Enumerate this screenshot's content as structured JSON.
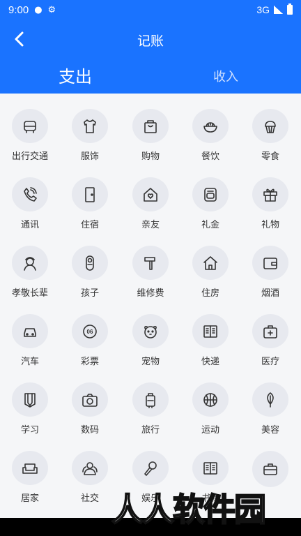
{
  "status": {
    "time": "9:00",
    "network": "3G"
  },
  "header": {
    "title": "记账"
  },
  "tabs": [
    {
      "label": "支出"
    },
    {
      "label": "收入"
    }
  ],
  "categories": [
    {
      "label": "出行交通",
      "icon": "car-icon"
    },
    {
      "label": "服饰",
      "icon": "shirt-icon"
    },
    {
      "label": "购物",
      "icon": "bag-icon"
    },
    {
      "label": "餐饮",
      "icon": "bowl-icon"
    },
    {
      "label": "零食",
      "icon": "cupcake-icon"
    },
    {
      "label": "通讯",
      "icon": "phone-icon"
    },
    {
      "label": "住宿",
      "icon": "door-icon"
    },
    {
      "label": "亲友",
      "icon": "home-heart-icon"
    },
    {
      "label": "礼金",
      "icon": "gift-envelope-icon"
    },
    {
      "label": "礼物",
      "icon": "gift-icon"
    },
    {
      "label": "孝敬长辈",
      "icon": "elder-icon"
    },
    {
      "label": "孩子",
      "icon": "baby-icon"
    },
    {
      "label": "维修费",
      "icon": "hammer-icon"
    },
    {
      "label": "住房",
      "icon": "house-icon"
    },
    {
      "label": "烟酒",
      "icon": "wallet-icon"
    },
    {
      "label": "汽车",
      "icon": "car-front-icon"
    },
    {
      "label": "彩票",
      "icon": "lottery-icon"
    },
    {
      "label": "宠物",
      "icon": "pet-icon"
    },
    {
      "label": "快递",
      "icon": "book-icon"
    },
    {
      "label": "医疗",
      "icon": "medical-kit-icon"
    },
    {
      "label": "学习",
      "icon": "pencil-icon"
    },
    {
      "label": "数码",
      "icon": "camera-icon"
    },
    {
      "label": "旅行",
      "icon": "luggage-icon"
    },
    {
      "label": "运动",
      "icon": "basketball-icon"
    },
    {
      "label": "美容",
      "icon": "leaf-icon"
    },
    {
      "label": "居家",
      "icon": "sofa-icon"
    },
    {
      "label": "社交",
      "icon": "people-icon"
    },
    {
      "label": "娱乐",
      "icon": "microphone-icon"
    },
    {
      "label": "书籍",
      "icon": "book-open-icon"
    },
    {
      "label": "",
      "icon": "briefcase-icon"
    }
  ],
  "watermark": "人人软件园",
  "colors": {
    "primary": "#1a73ff",
    "circle": "#e7e9ef",
    "text": "#333333"
  }
}
